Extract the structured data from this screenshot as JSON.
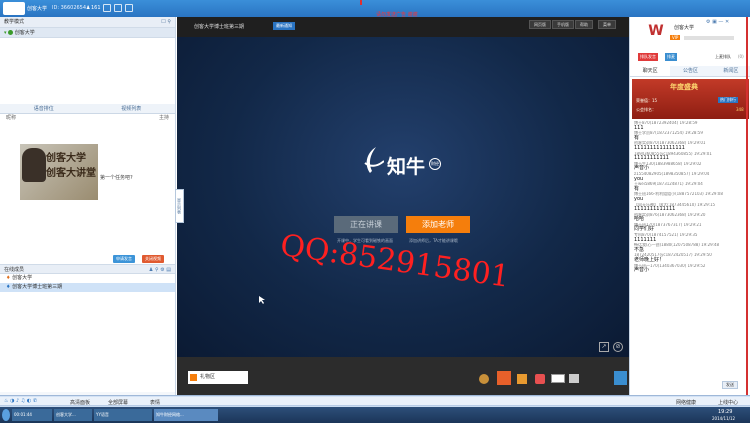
{
  "window": {
    "app_name": "创客大学",
    "id_text": "ID: 36602654",
    "user_count": "161",
    "center_title": "创客大学博士班第三期",
    "notice": "最新通知",
    "red_text": "请勿发送广告  谢谢",
    "top_buttons": [
      "网页版",
      "手机版",
      "帮助",
      "菜单"
    ]
  },
  "left": {
    "mode_label": "教学模式",
    "tree_item": "创客大学",
    "tab_a": "语音排位",
    "tab_b": "视频列表",
    "col_a": "昵称",
    "col_b": "主持",
    "cam_line1": "创客大学",
    "cam_line2": "创客大讲堂",
    "cam_side": "第一个任务吧?",
    "btn_apply": "申请发言",
    "btn_close": "关闭视频",
    "section_label": "在线成员",
    "member1": "创客大学",
    "member2": "创客大学博士班第三期",
    "side_tab": "显示列表"
  },
  "stage": {
    "logo_text": "知牛",
    "logo_badge": "财经",
    "btn_left": "正在讲课",
    "btn_right": "添加老师",
    "sub_left": "开课中，学生可看到磁铁的画面",
    "sub_right": "添加讲师后，TA才能讲课哦",
    "gift_label": "礼物区"
  },
  "right": {
    "user_name": "创客大学",
    "badge": "VIP",
    "rank_label": "上麦排队",
    "rank_count": "(0)",
    "tabs": [
      "聊天区",
      "公告区",
      "新闻区"
    ],
    "banner": "年度盛典",
    "banner_sub": "热门排行",
    "honor_label": "荣誉值：15",
    "honor_val": "348",
    "rank_small": "公会排名：",
    "messages": [
      {
        "user": "博士870(1872392404)  19:28:59",
        "content": "111"
      },
      {
        "user": "博士学员87(1872371254)  19:28:59",
        "content": "有"
      },
      {
        "user": "创客实训870(1873062368)  19:29:01",
        "content": "1111111111111111"
      },
      {
        "user": "1894360855(yc1894360855)  19:29:01",
        "content": "11111111111"
      },
      {
        "user": "博士生130(1883988658)  19:29:02",
        "content": "声音小"
      },
      {
        "user": "z1554082905(1898350857)  19:29:04",
        "content": "you"
      },
      {
        "user": "王wei5869(1873124871)  19:29:04",
        "content": "有"
      },
      {
        "user": "博士班166-利利姐姐小(1887572103)  19:29:08",
        "content": "you"
      },
      {
        "user": "【同天乐神】 国大(1873445610)  19:29:15",
        "content": "1111111111111"
      },
      {
        "user": "创客实训876(1873062368)  19:29:20",
        "content": "哈哈"
      },
      {
        "user": "博士班170(1873767317)  19:29:21",
        "content": "同学们好"
      },
      {
        "user": "专科870(1874157521)  19:29:35",
        "content": "1111111"
      },
      {
        "user": "畅话我(心一创)1880(1207508788)  19:29:48",
        "content": "不急"
      },
      {
        "user": "1872420517(yc1872420517)  19:29:50",
        "content": "老师晚上好！"
      },
      {
        "user": "博士班一170(1340367030)  19:29:52",
        "content": "声音小"
      }
    ],
    "send_label": "发送",
    "bottom_label": "我的"
  },
  "taskbar": {
    "items": [
      "高清面板",
      "全部屏幕",
      "表情",
      "聊天"
    ],
    "task_btns": [
      "00:01:44",
      "创客大学...",
      "YY语音",
      "知牛财经网络..."
    ],
    "clock": "19:29",
    "date": "2014/11/12",
    "right_status": "网络健康",
    "connect": "上线中心"
  },
  "watermark": "QQ:852915801",
  "colors": {
    "accent": "#2a74c2",
    "orange": "#f57e0c",
    "red": "#ff2020"
  }
}
